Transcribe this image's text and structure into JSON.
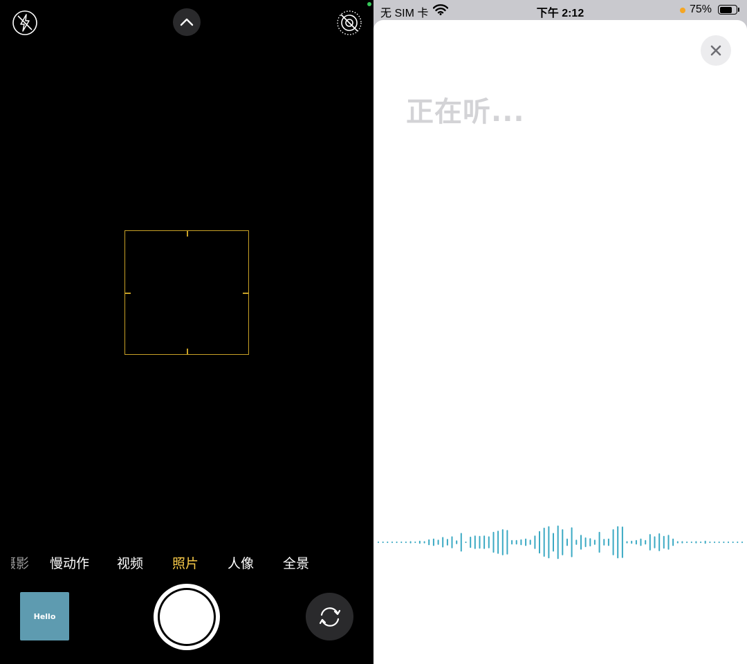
{
  "camera": {
    "modes": {
      "cut": "摄影",
      "slomo": "慢动作",
      "video": "视频",
      "photo": "照片",
      "portrait": "人像",
      "pano": "全景"
    },
    "selected_mode": "照片",
    "thumbnail_text": "Hello",
    "colors": {
      "selected_mode": "#f7c948",
      "focus_box": "#c9a227",
      "thumbnail": "#5e9bb0"
    },
    "icons": {
      "flash": "flash-off-icon",
      "chevron": "chevron-up-icon",
      "live": "live-photo-off-icon",
      "flip": "camera-flip-icon"
    }
  },
  "status_bar": {
    "carrier": "无 SIM 卡",
    "time": "下午 2:12",
    "battery_pct": "75%",
    "battery_level": 0.75
  },
  "voice_sheet": {
    "listening_text": "正在听...",
    "close_icon": "close-icon",
    "wave_color": "#3aa9c3",
    "wave_amplitudes": [
      0.04,
      0.04,
      0.04,
      0.04,
      0.04,
      0.04,
      0.04,
      0.06,
      0.04,
      0.08,
      0.06,
      0.16,
      0.2,
      0.14,
      0.28,
      0.18,
      0.32,
      0.1,
      0.5,
      0.04,
      0.3,
      0.36,
      0.34,
      0.36,
      0.32,
      0.56,
      0.62,
      0.7,
      0.66,
      0.12,
      0.12,
      0.16,
      0.2,
      0.14,
      0.36,
      0.6,
      0.78,
      0.86,
      0.5,
      0.9,
      0.7,
      0.2,
      0.8,
      0.14,
      0.4,
      0.26,
      0.22,
      0.14,
      0.56,
      0.18,
      0.2,
      0.7,
      0.86,
      0.84,
      0.06,
      0.08,
      0.12,
      0.2,
      0.12,
      0.44,
      0.32,
      0.48,
      0.34,
      0.4,
      0.2,
      0.06,
      0.06,
      0.04,
      0.04,
      0.06,
      0.04,
      0.08,
      0.04,
      0.04,
      0.04,
      0.04,
      0.04,
      0.04,
      0.04,
      0.04
    ]
  }
}
